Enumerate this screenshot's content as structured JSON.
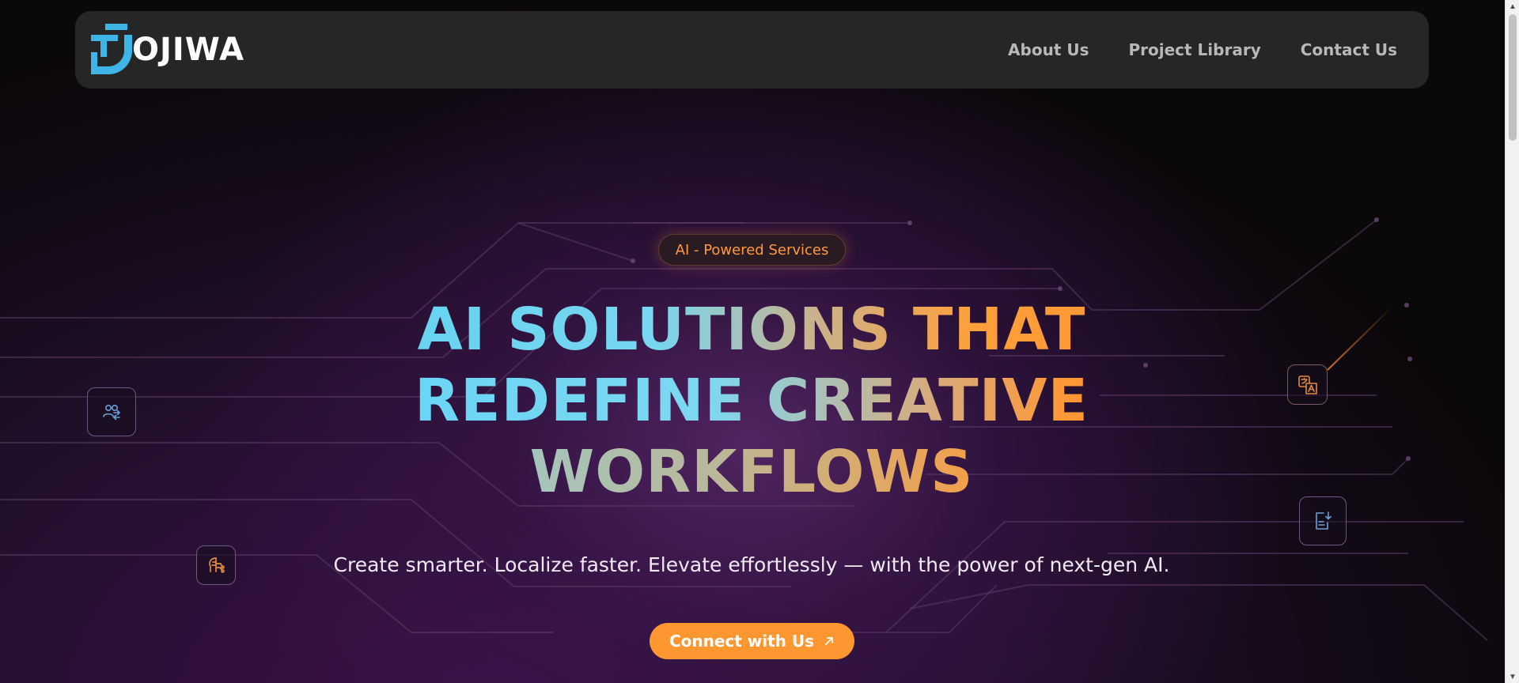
{
  "brand": {
    "name": "OJIWA",
    "colors": {
      "logo_blue": "#3fb4e6",
      "accent_orange": "#ff9730",
      "nav_bg": "#262626"
    }
  },
  "nav": {
    "items": [
      {
        "label": "About Us"
      },
      {
        "label": "Project Library"
      },
      {
        "label": "Contact Us"
      }
    ]
  },
  "hero": {
    "badge": "AI - Powered Services",
    "headline": {
      "line1": "AI SOLUTIONS THAT",
      "line2": "REDEFINE CREATIVE",
      "line3": "WORKFLOWS"
    },
    "subtitle": "Create smarter. Localize faster. Elevate effortlessly — with the power of next-gen AI.",
    "cta_label": "Connect with Us"
  },
  "icons": {
    "people": "people-exchange-icon",
    "brain": "brain-circuit-icon",
    "translate": "translate-icon",
    "document": "document-download-icon",
    "cta_arrow": "arrow-up-right-icon"
  }
}
